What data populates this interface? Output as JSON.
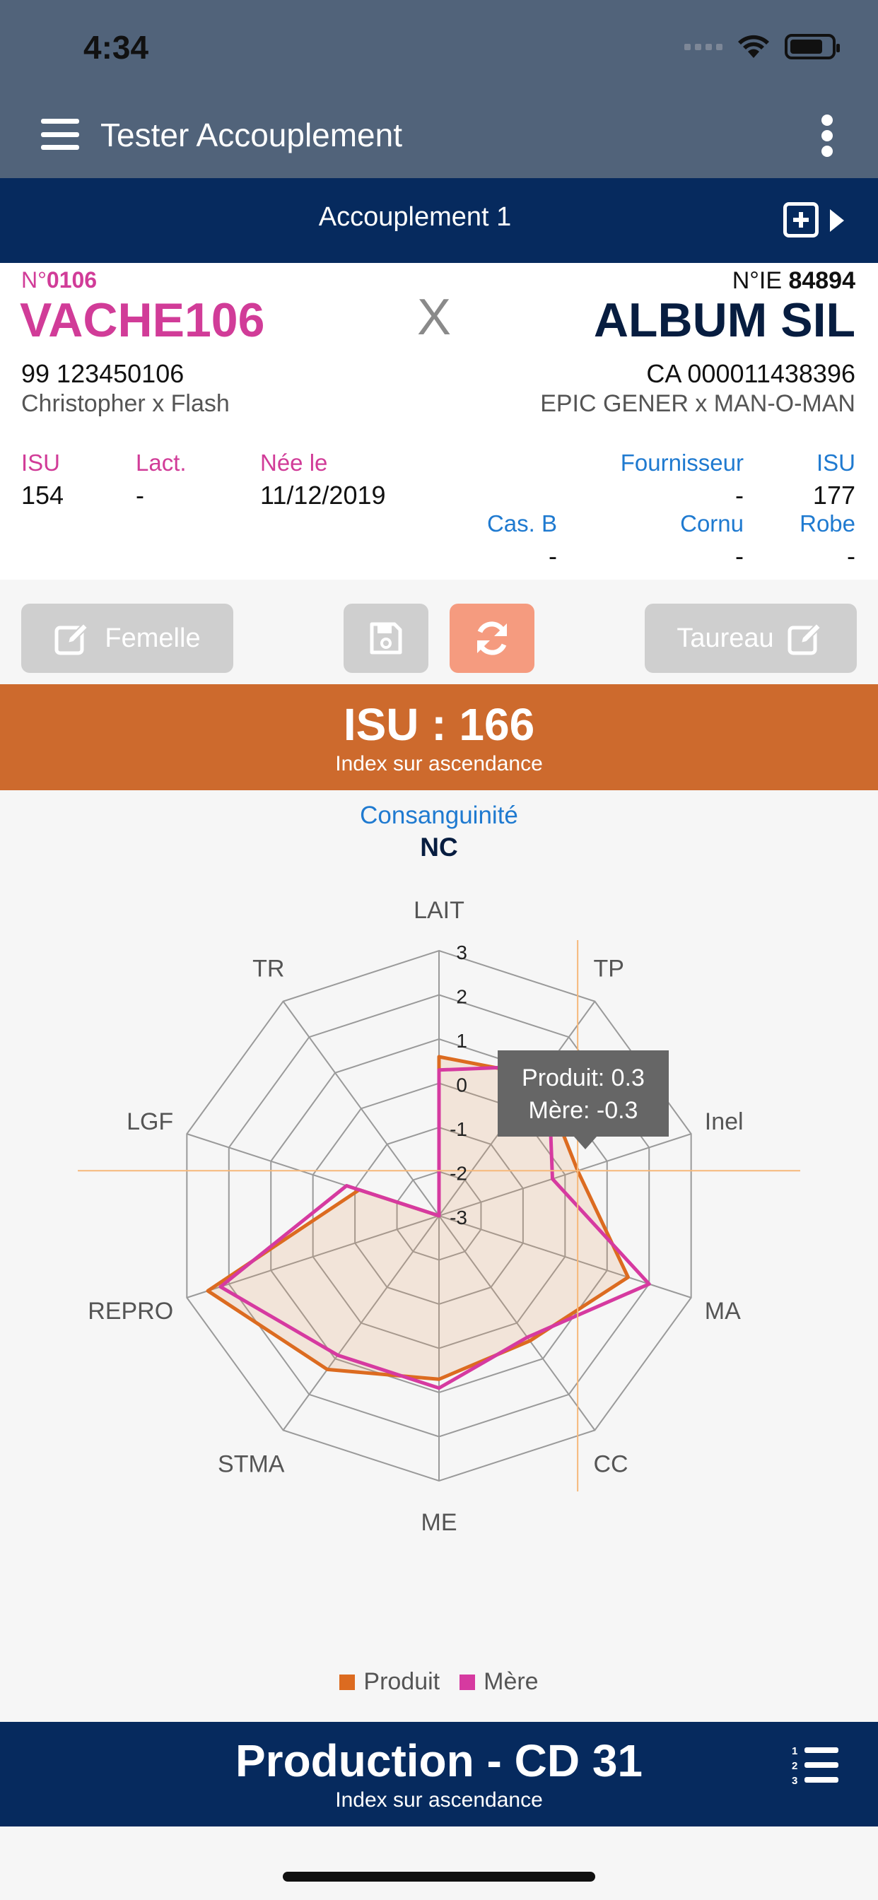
{
  "status_bar": {
    "time": "4:34"
  },
  "app_bar": {
    "title": "Tester Accouplement"
  },
  "tab": {
    "title": "Accouplement 1"
  },
  "female": {
    "num_prefix": "N°",
    "num": "0106",
    "name": "VACHE106",
    "id": "99 123450106",
    "pedigree": "Christopher x Flash",
    "isu_label": "ISU",
    "isu": "154",
    "lact_label": "Lact.",
    "lact": "-",
    "born_label": "Née le",
    "born": "11/12/2019"
  },
  "cross_symbol": "X",
  "male": {
    "num_prefix": "N°IE",
    "num": "84894",
    "name": "ALBUM SIL",
    "id": "CA 000011438396",
    "pedigree": "EPIC GENER x MAN-O-MAN",
    "fournisseur_label": "Fournisseur",
    "fournisseur": "-",
    "isu_label": "ISU",
    "isu": "177",
    "casb_label": "Cas. B",
    "casb": "-",
    "cornu_label": "Cornu",
    "cornu": "-",
    "robe_label": "Robe",
    "robe": "-"
  },
  "buttons": {
    "femelle": "Femelle",
    "taureau": "Taureau"
  },
  "isu_banner": {
    "title": "ISU : 166",
    "subtitle": "Index sur ascendance"
  },
  "consanguinite": {
    "label": "Consanguinité",
    "value": "NC"
  },
  "tooltip": {
    "line1": "Produit: 0.3",
    "line2": "Mère: -0.3"
  },
  "legend": {
    "produit": "Produit",
    "mere": "Mère"
  },
  "production_banner": {
    "title": "Production - CD 31",
    "subtitle": "Index sur ascendance"
  },
  "colors": {
    "produit": "#dc6b20",
    "mere": "#d63aa0",
    "orange_banner": "#cd6a2d",
    "navy": "#062a5e"
  },
  "chart_data": {
    "type": "radar",
    "axes": [
      "LAIT",
      "TP",
      "Inel",
      "MA",
      "CC",
      "ME",
      "STMA",
      "REPRO",
      "LGF",
      "TR"
    ],
    "rlim": [
      -3,
      3
    ],
    "ticks": [
      "3",
      "2",
      "1",
      "0",
      "-1",
      "-2",
      "-3"
    ],
    "series": [
      {
        "name": "Produit",
        "values": [
          0.6,
          0.9,
          0.3,
          1.5,
          0.5,
          0.7,
          1.3,
          2.5,
          -1.1,
          -3
        ]
      },
      {
        "name": "Mère",
        "values": [
          0.3,
          1.2,
          -0.3,
          2.0,
          0.4,
          0.9,
          0.9,
          2.2,
          -0.8,
          -3
        ]
      }
    ]
  }
}
